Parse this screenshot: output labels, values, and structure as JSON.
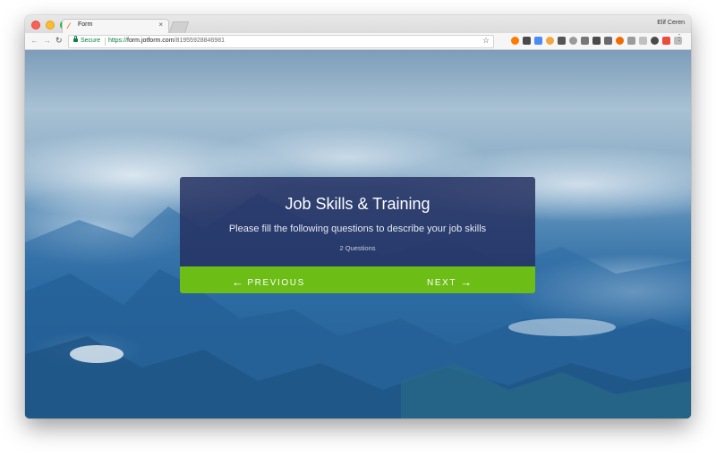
{
  "browser": {
    "tab_title": "Form",
    "tab_close": "×",
    "profile_name": "Elif Ceren",
    "secure_label": "Secure",
    "url_scheme": "https://",
    "url_host": "form.jotform.com",
    "url_path": "/81955928846981"
  },
  "colors": {
    "secure_green": "#0b8043",
    "card_bg": "#253061",
    "button_bar": "#6cbd16",
    "extension_icons": [
      "#ff7a00",
      "#4a4a4a",
      "#4c8bf5",
      "#f2a541",
      "#555555",
      "#9b9b9b",
      "#777777",
      "#4a4a4a",
      "#6a6a6a",
      "#ef6c00",
      "#9b9b9b",
      "#c0c0c0",
      "#4a4a4a",
      "#e94b3c",
      "#bdbdbd"
    ]
  },
  "form": {
    "title": "Job Skills & Training",
    "description": "Please fill the following questions to describe your job skills",
    "question_count": "2 Questions",
    "previous_label": "PREVIOUS",
    "next_label": "NEXT"
  }
}
